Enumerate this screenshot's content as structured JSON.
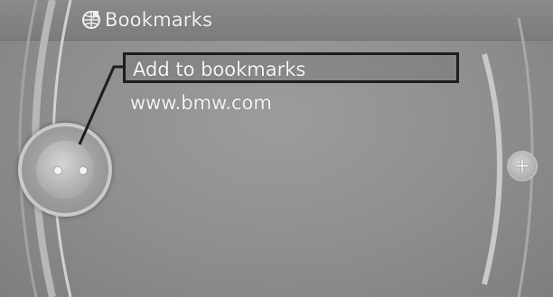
{
  "header": {
    "title": "Bookmarks",
    "icon": "bookmarks-icon"
  },
  "menu": {
    "items": [
      {
        "label": "Add to bookmarks",
        "selected": true
      },
      {
        "label": "www.bmw.com",
        "selected": false
      }
    ]
  },
  "controller": {
    "icon": "controller-knob-icon"
  },
  "right_button": {
    "label": "+",
    "icon": "plus-icon"
  }
}
